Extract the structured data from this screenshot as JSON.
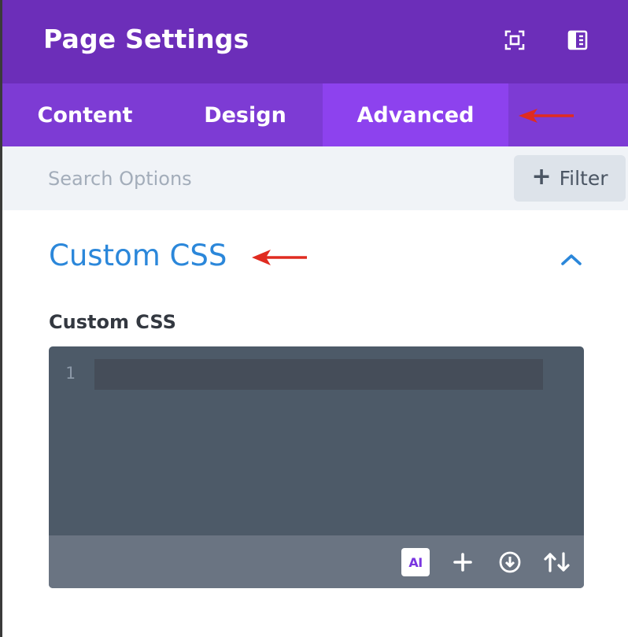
{
  "header": {
    "title": "Page Settings",
    "icons": [
      "fullscreen-icon",
      "sidebar-toggle-icon"
    ],
    "bg_color": "#6c2eb9"
  },
  "tabs": [
    {
      "label": "Content",
      "active": false
    },
    {
      "label": "Design",
      "active": false
    },
    {
      "label": "Advanced",
      "active": true
    }
  ],
  "search": {
    "placeholder": "Search Options",
    "value": "",
    "filter_label": "Filter"
  },
  "section": {
    "title": "Custom CSS",
    "expanded": true
  },
  "field": {
    "label": "Custom CSS",
    "line_number": "1",
    "code": ""
  },
  "editor_toolbar": {
    "ai_label": "AI",
    "icons": [
      "ai-icon",
      "add-icon",
      "download-icon",
      "sort-icon"
    ]
  },
  "colors": {
    "accent": "#2b87da",
    "tab_bar": "#7d3bd4",
    "active_tab": "#8d42ee",
    "annotation_arrow": "#e02b20"
  }
}
